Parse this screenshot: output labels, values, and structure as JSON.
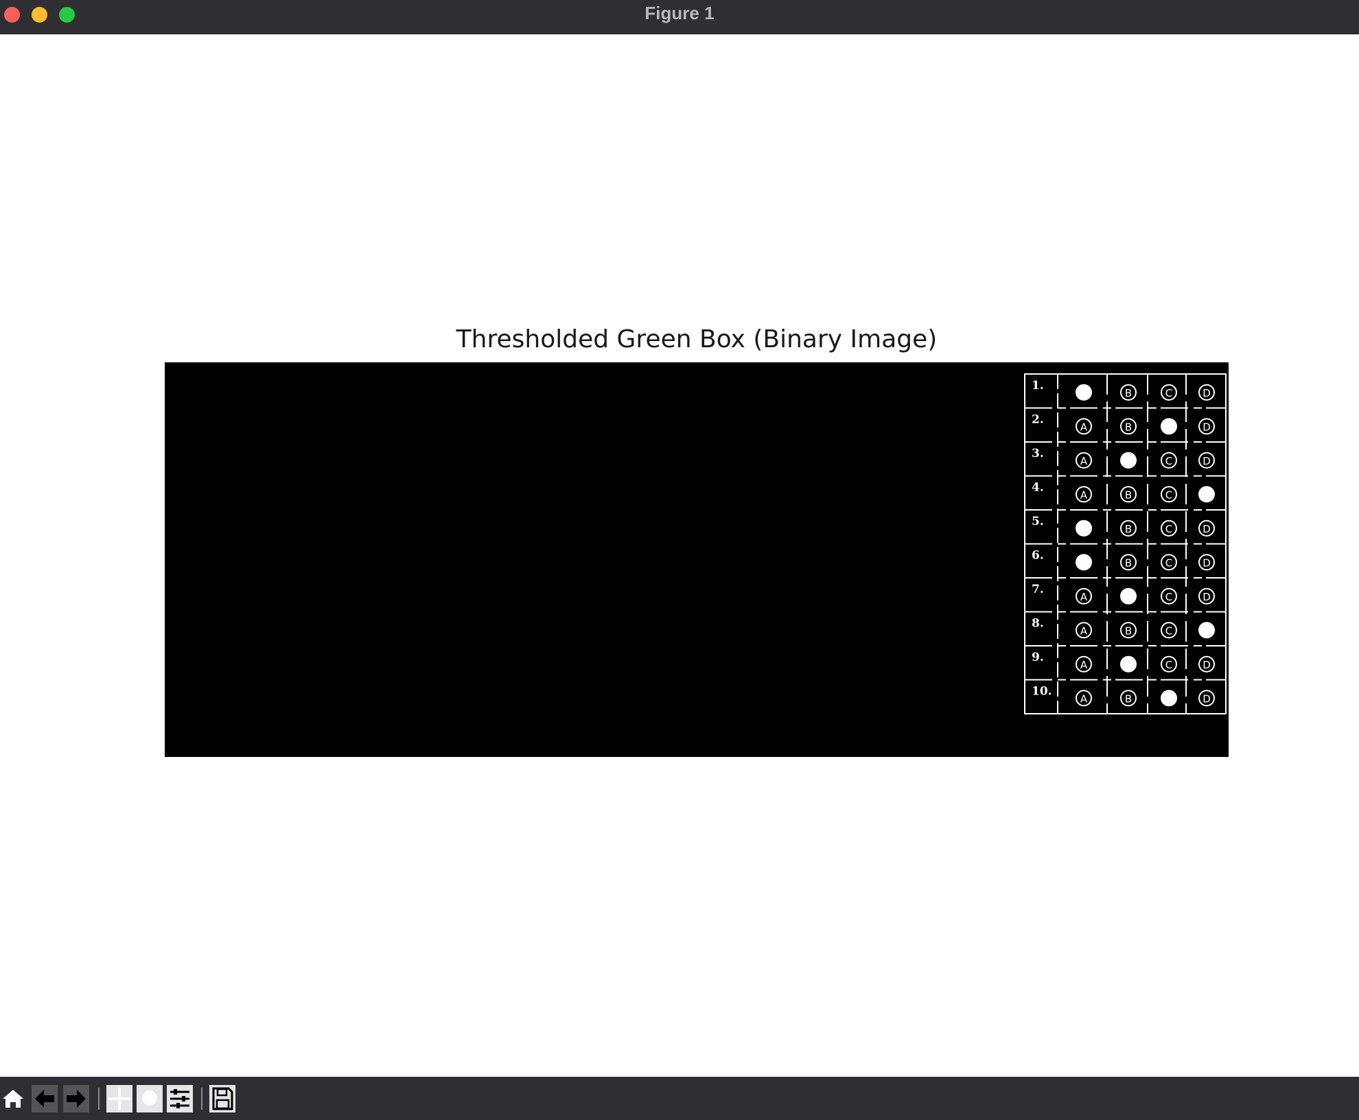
{
  "window": {
    "title": "Figure 1"
  },
  "figure": {
    "axes_title": "Thresholded Green Box (Binary Image)",
    "answer_grid": {
      "options": [
        "A",
        "B",
        "C",
        "D"
      ],
      "rows": [
        {
          "label": "1.",
          "filled": "A"
        },
        {
          "label": "2.",
          "filled": "C"
        },
        {
          "label": "3.",
          "filled": "B"
        },
        {
          "label": "4.",
          "filled": "D"
        },
        {
          "label": "5.",
          "filled": "A"
        },
        {
          "label": "6.",
          "filled": "A"
        },
        {
          "label": "7.",
          "filled": "B"
        },
        {
          "label": "8.",
          "filled": "D"
        },
        {
          "label": "9.",
          "filled": "B"
        },
        {
          "label": "10.",
          "filled": "C"
        }
      ]
    }
  },
  "toolbar": {
    "buttons": [
      {
        "name": "home-button",
        "icon": "home-icon"
      },
      {
        "name": "back-button",
        "icon": "arrow-left-icon"
      },
      {
        "name": "forward-button",
        "icon": "arrow-right-icon"
      },
      {
        "name": "pan-button",
        "icon": "move-icon"
      },
      {
        "name": "zoom-button",
        "icon": "zoom-icon"
      },
      {
        "name": "configure-subplots-button",
        "icon": "sliders-icon"
      },
      {
        "name": "save-button",
        "icon": "save-icon"
      }
    ]
  },
  "colors": {
    "titlebar": "#2f2f33",
    "close": "#fe5f57",
    "minimize": "#febc2e",
    "maximize": "#28c840",
    "image_background": "#000000",
    "image_foreground": "#ffffff"
  }
}
